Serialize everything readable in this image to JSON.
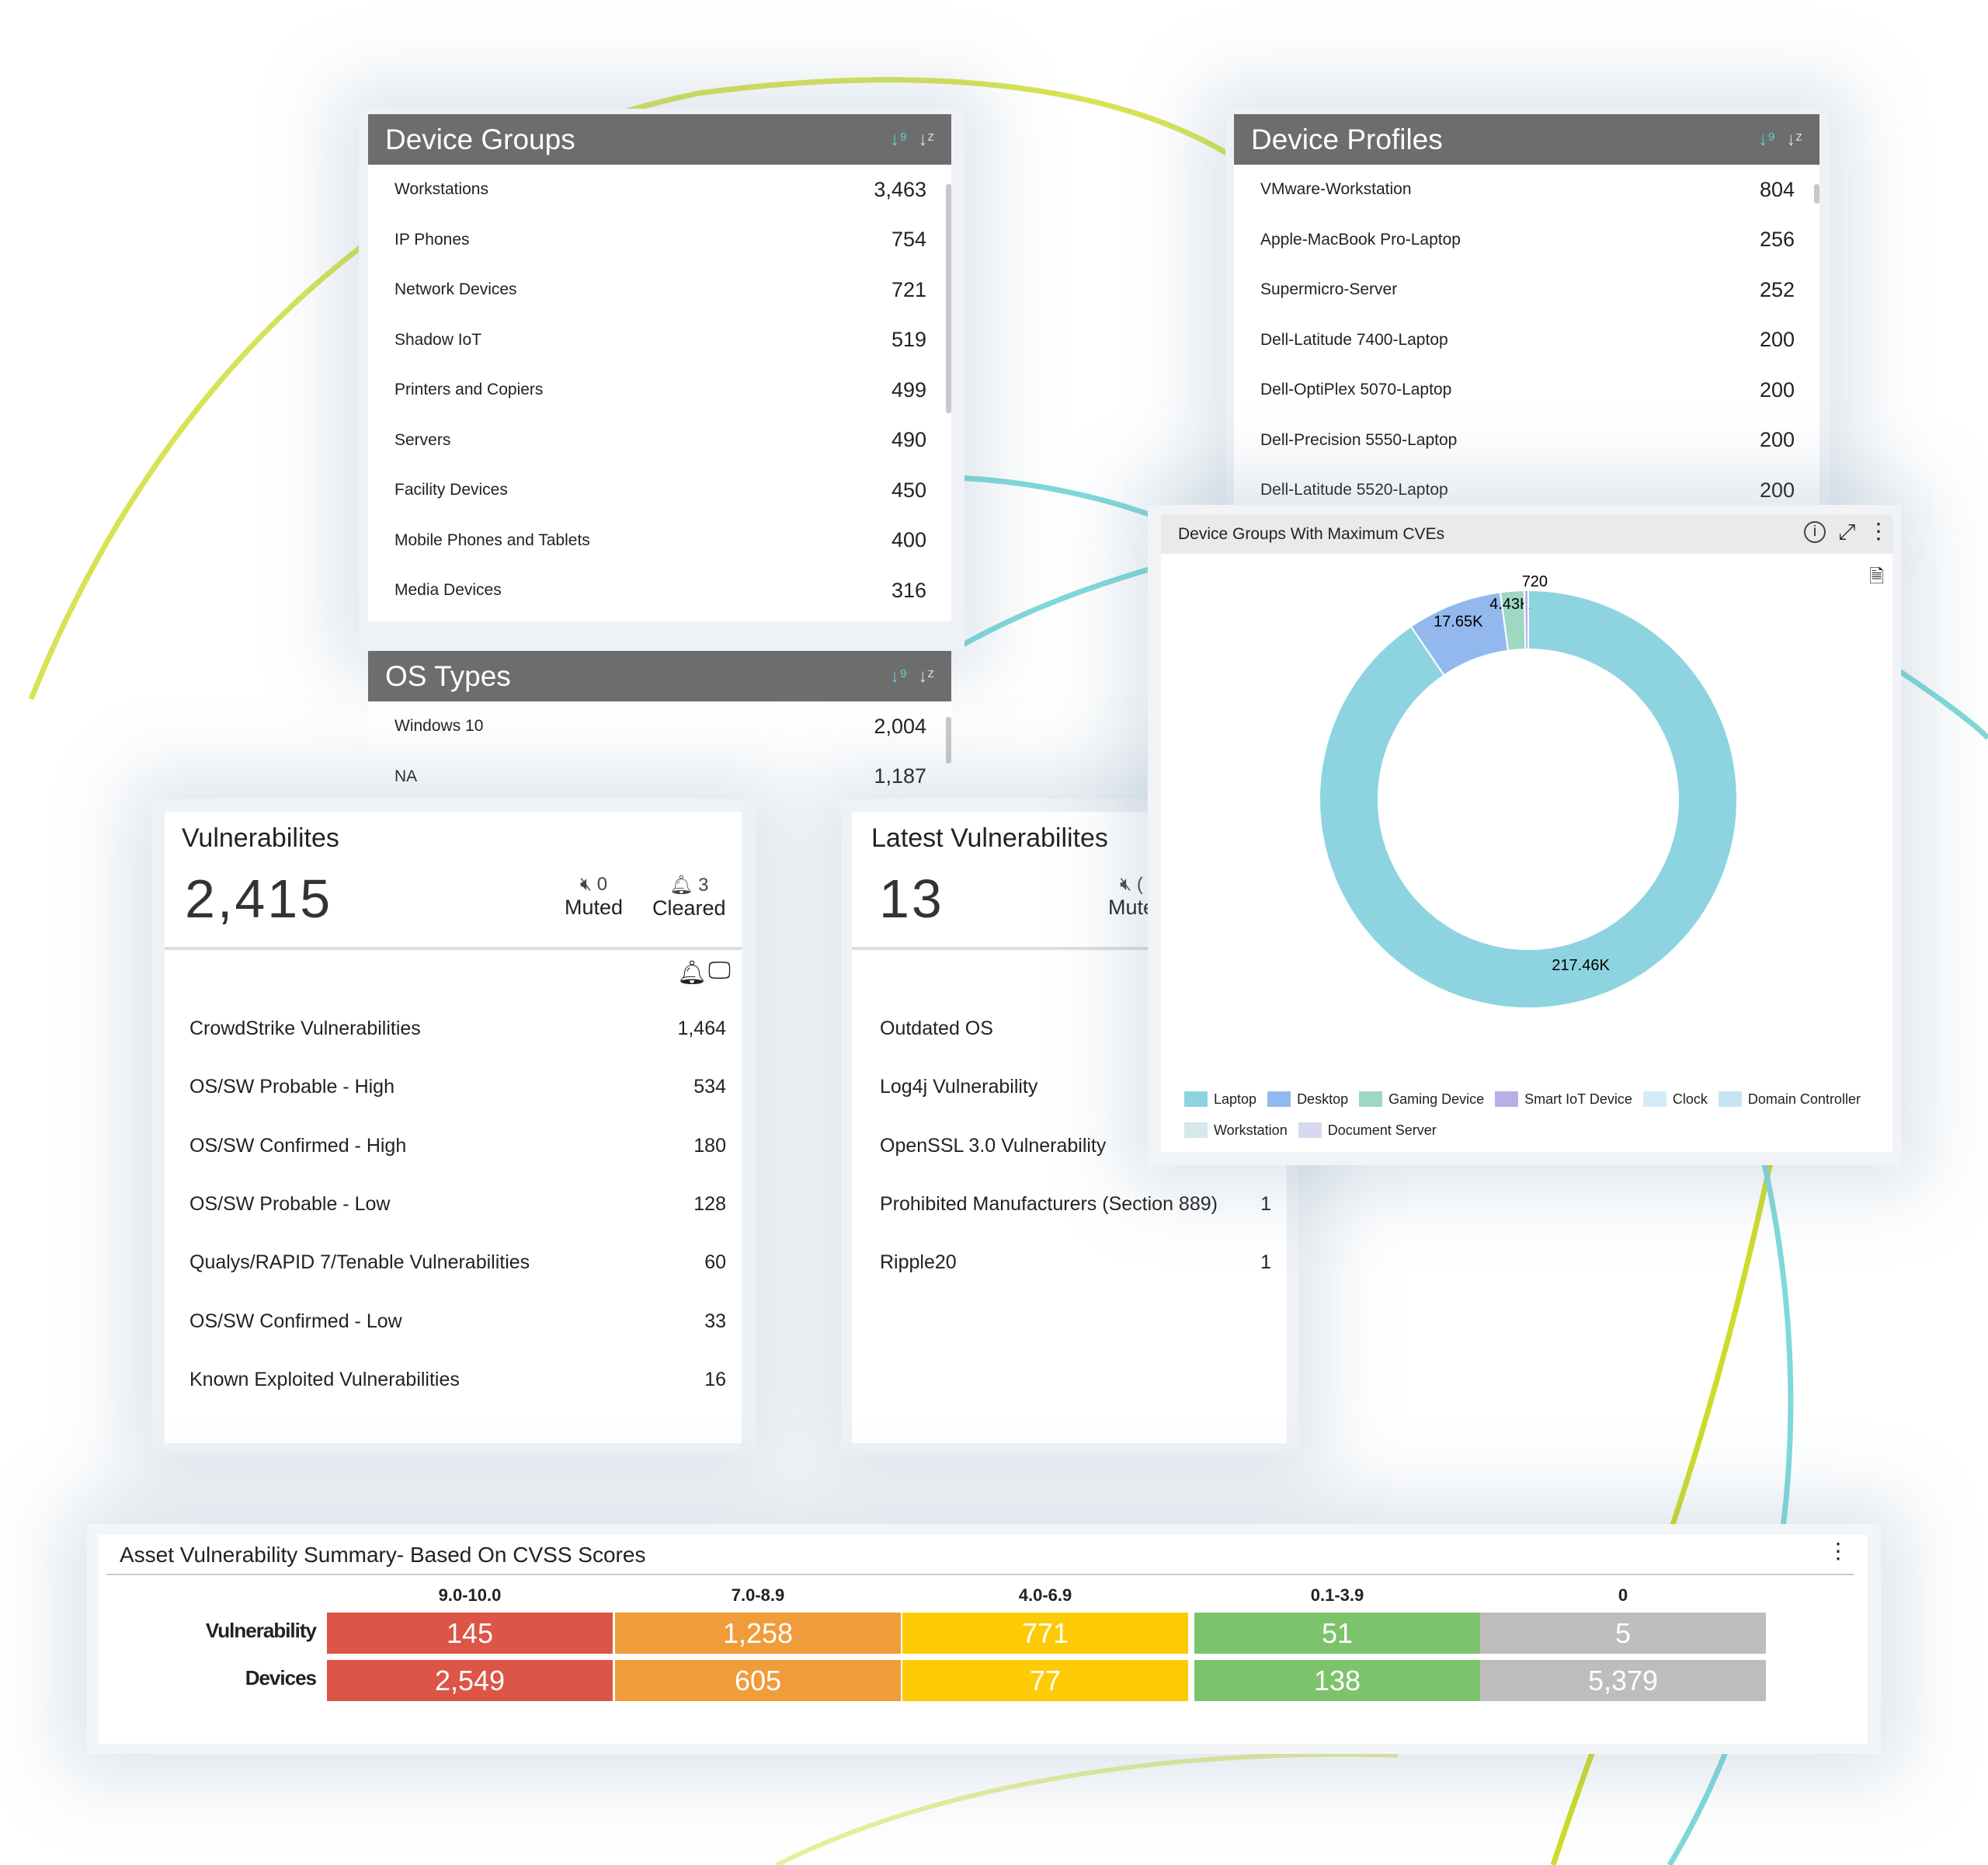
{
  "device_groups": {
    "title": "Device Groups",
    "items": [
      {
        "label": "Workstations",
        "value": "3,463"
      },
      {
        "label": "IP Phones",
        "value": "754"
      },
      {
        "label": "Network Devices",
        "value": "721"
      },
      {
        "label": "Shadow IoT",
        "value": "519"
      },
      {
        "label": "Printers and Copiers",
        "value": "499"
      },
      {
        "label": "Servers",
        "value": "490"
      },
      {
        "label": "Facility Devices",
        "value": "450"
      },
      {
        "label": "Mobile Phones and Tablets",
        "value": "400"
      },
      {
        "label": "Media Devices",
        "value": "316"
      }
    ]
  },
  "os_types": {
    "title": "OS Types",
    "items": [
      {
        "label": "Windows 10",
        "value": "2,004"
      },
      {
        "label": "NA",
        "value": "1,187"
      }
    ]
  },
  "device_profiles": {
    "title": "Device Profiles",
    "items": [
      {
        "label": "VMware-Workstation",
        "value": "804"
      },
      {
        "label": "Apple-MacBook Pro-Laptop",
        "value": "256"
      },
      {
        "label": "Supermicro-Server",
        "value": "252"
      },
      {
        "label": "Dell-Latitude 7400-Laptop",
        "value": "200"
      },
      {
        "label": "Dell-OptiPlex 5070-Laptop",
        "value": "200"
      },
      {
        "label": "Dell-Precision 5550-Laptop",
        "value": "200"
      },
      {
        "label": "Dell-Latitude 5520-Laptop",
        "value": "200"
      }
    ]
  },
  "sort_icons": {
    "a": "↓⁹",
    "b": "↓ᶻ"
  },
  "vulnerabilities": {
    "title": "Vulnerabilites",
    "total": "2,415",
    "muted_count": "0",
    "muted_label": "Muted",
    "cleared_count": "3",
    "cleared_label": "Cleared",
    "items": [
      {
        "label": "CrowdStrike Vulnerabilities",
        "value": "1,464"
      },
      {
        "label": "OS/SW Probable - High",
        "value": "534"
      },
      {
        "label": "OS/SW Confirmed - High",
        "value": "180"
      },
      {
        "label": "OS/SW Probable - Low",
        "value": "128"
      },
      {
        "label": "Qualys/RAPID 7/Tenable Vulnerabilities",
        "value": "60"
      },
      {
        "label": "OS/SW Confirmed - Low",
        "value": "33"
      },
      {
        "label": "Known Exploited Vulnerabilities",
        "value": "16"
      }
    ]
  },
  "latest": {
    "title": "Latest Vulnerabilites",
    "total": "13",
    "muted_label": "Mute",
    "muted_count": "(",
    "items": [
      {
        "label": "Outdated OS",
        "value": ""
      },
      {
        "label": "Log4j Vulnerability",
        "value": ""
      },
      {
        "label": "OpenSSL 3.0 Vulnerability",
        "value": ""
      },
      {
        "label": "Prohibited Manufacturers (Section 889)",
        "value": "1"
      },
      {
        "label": "Ripple20",
        "value": "1"
      }
    ]
  },
  "chart_data": {
    "type": "pie",
    "title": "Device Groups With Maximum CVEs",
    "slices": [
      {
        "name": "Laptop",
        "value": 217460,
        "label": "217.46K",
        "color": "#8dd4e0"
      },
      {
        "name": "Desktop",
        "value": 17650,
        "label": "17.65K",
        "color": "#93b8ee"
      },
      {
        "name": "Gaming Device",
        "value": 4430,
        "label": "4.43K",
        "color": "#9ed8c2"
      },
      {
        "name": "Smart IoT Device",
        "value": 720,
        "label": "720",
        "color": "#b9aee8"
      }
    ],
    "legend": [
      {
        "name": "Laptop",
        "color": "#8dd4e0"
      },
      {
        "name": "Desktop",
        "color": "#93b8ee"
      },
      {
        "name": "Gaming Device",
        "color": "#9ed8c2"
      },
      {
        "name": "Smart IoT Device",
        "color": "#b9aee8"
      },
      {
        "name": "Clock",
        "color": "#d3ecf7"
      },
      {
        "name": "Domain Controller",
        "color": "#c5e5f5"
      },
      {
        "name": "Workstation",
        "color": "#d5e8ea"
      },
      {
        "name": "Document Server",
        "color": "#d8d8f0"
      }
    ],
    "legend_position": "bottom"
  },
  "summary": {
    "title": "Asset Vulnerability Summary- Based On CVSS Scores",
    "columns": [
      "9.0-10.0",
      "7.0-8.9",
      "4.0-6.9",
      "0.1-3.9",
      "0"
    ],
    "colors": [
      "#dc5546",
      "#f09c3a",
      "#fccb05",
      "#7dc36c",
      "#bdbdbd"
    ],
    "rows": [
      {
        "label": "Vulnerability",
        "values": [
          "145",
          "1,258",
          "771",
          "51",
          "5"
        ]
      },
      {
        "label": "Devices",
        "values": [
          "2,549",
          "605",
          "77",
          "138",
          "5,379"
        ]
      }
    ]
  }
}
